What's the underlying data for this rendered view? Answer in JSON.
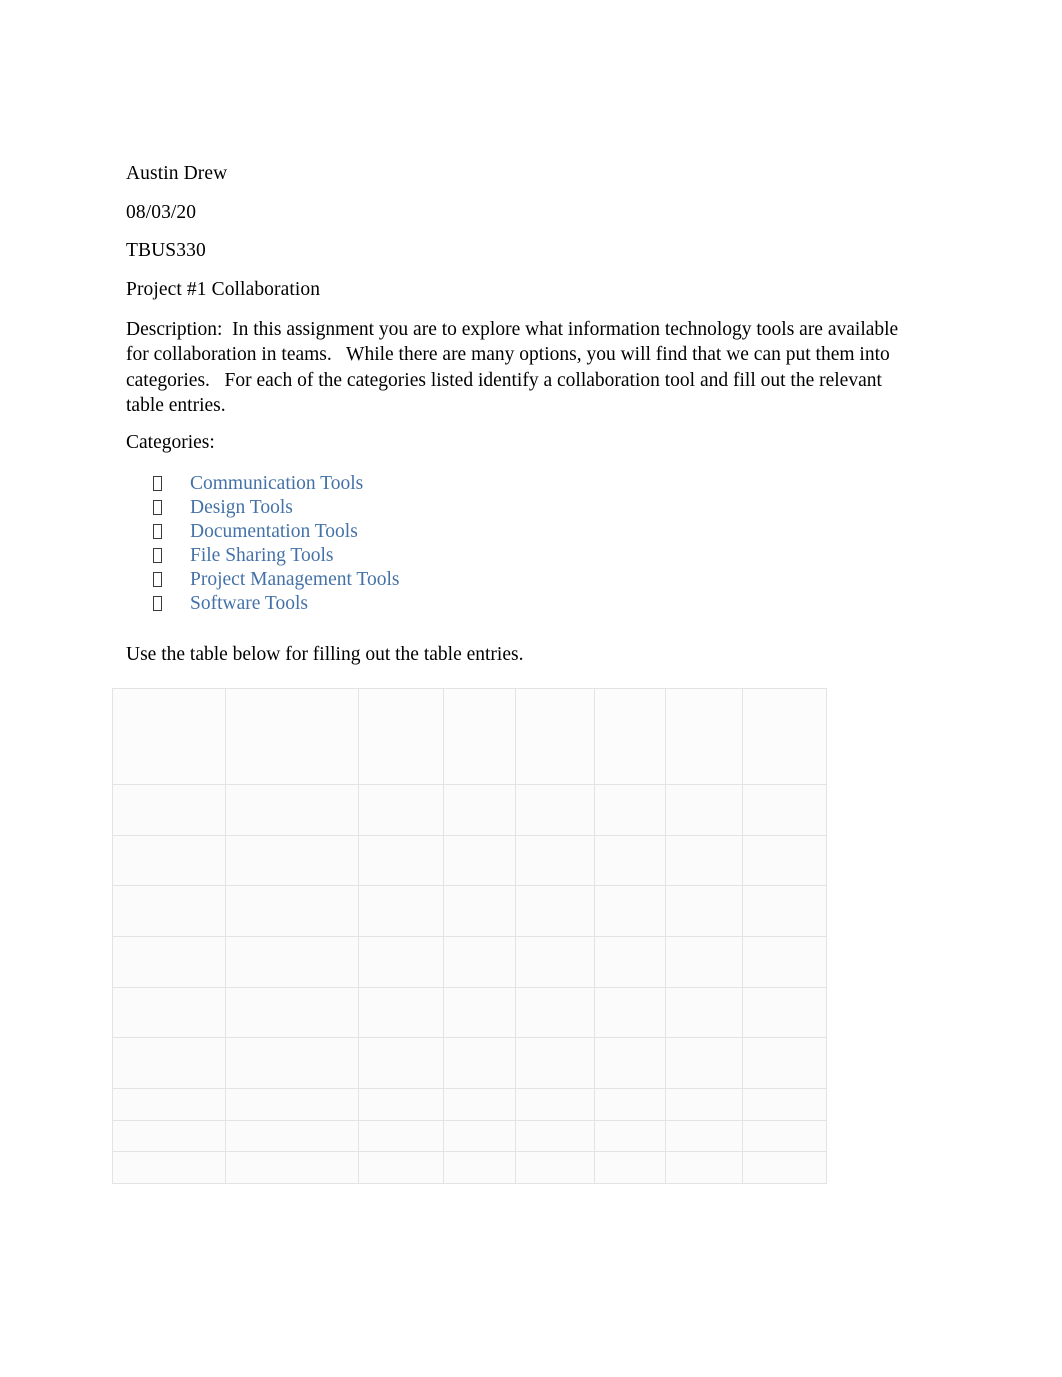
{
  "document": {
    "header_lines": [
      "Austin Drew",
      "08/03/20",
      "TBUS330",
      "Project #1 Collaboration"
    ],
    "description": "Description:  In this assignment you are to explore what information technology tools are available for collaboration in teams.   While there are many options, you will find that we can put them into categories.   For each of the categories listed identify a collaboration tool and fill out the relevant table entries.",
    "categories_label": "Categories:",
    "categories": [
      {
        "bullet": "missing-glyph-box",
        "label": "Communication Tools"
      },
      {
        "bullet": "missing-glyph-box",
        "label": "Design Tools"
      },
      {
        "bullet": "missing-glyph-box",
        "label": "Documentation Tools"
      },
      {
        "bullet": "missing-glyph-box",
        "label": "File Sharing Tools"
      },
      {
        "bullet": "missing-glyph-box",
        "label": "Project Management Tools"
      },
      {
        "bullet": "missing-glyph-box",
        "label": "Software Tools"
      }
    ],
    "table_instruction": "Use the table below for filling out the table entries.",
    "colors": {
      "list_text": "#4472a8",
      "body_text": "#000000",
      "page_background": "#ffffff",
      "table_border": "#e3e3e3"
    }
  },
  "table": {
    "redacted": true,
    "note": "Table contents are blurred/redacted in the source screenshot and are not legible.",
    "column_count": 8,
    "headers": [
      "",
      "",
      "",
      "",
      "",
      "",
      "",
      ""
    ],
    "rows": [
      [
        "",
        "",
        "",
        "",
        "",
        "",
        "",
        ""
      ],
      [
        "",
        "",
        "",
        "",
        "",
        "",
        "",
        ""
      ],
      [
        "",
        "",
        "",
        "",
        "",
        "",
        "",
        ""
      ],
      [
        "",
        "",
        "",
        "",
        "",
        "",
        "",
        ""
      ],
      [
        "",
        "",
        "",
        "",
        "",
        "",
        "",
        ""
      ],
      [
        "",
        "",
        "",
        "",
        "",
        "",
        "",
        ""
      ]
    ],
    "blank_rows": 3
  }
}
